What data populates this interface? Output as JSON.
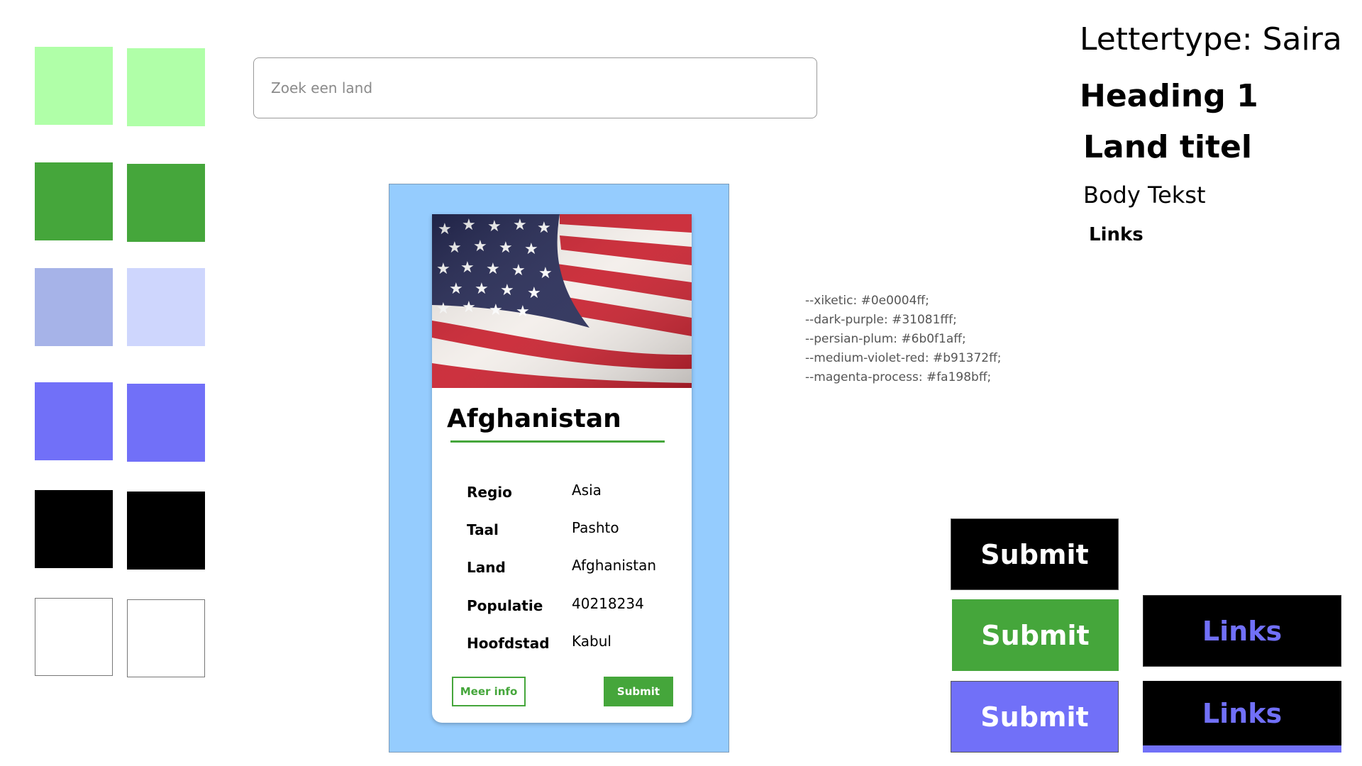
{
  "swatches": {
    "left": [
      "#b0ffa8",
      "#45a63b",
      "#a6b3e8",
      "#7170f8",
      "#000000",
      "#ffffff"
    ],
    "right": [
      "#b0ffa8",
      "#45a63b",
      "#ced6fd",
      "#7170f8",
      "#000000",
      "#ffffff"
    ]
  },
  "search": {
    "placeholder": "Zoek een land"
  },
  "card": {
    "title": "Afghanistan",
    "rows": [
      {
        "label": "Regio",
        "value": "Asia"
      },
      {
        "label": "Taal",
        "value": "Pashto"
      },
      {
        "label": "Land",
        "value": "Afghanistan"
      },
      {
        "label": "Populatie",
        "value": "40218234"
      },
      {
        "label": "Hoofdstad",
        "value": "Kabul"
      }
    ],
    "more_info_label": "Meer info",
    "submit_label": "Submit"
  },
  "typography": {
    "font_label": "Lettertype: Saira",
    "heading1": "Heading 1",
    "land_titel": "Land titel",
    "body_tekst": "Body Tekst",
    "links": "Links"
  },
  "color_vars": [
    "--xiketic: #0e0004ff;",
    "--dark-purple: #31081fff;",
    "--persian-plum: #6b0f1aff;",
    "--medium-violet-red: #b91372ff;",
    "--magenta-process: #fa198bff;"
  ],
  "buttons": {
    "submit_black": "Submit",
    "submit_green": "Submit",
    "submit_purple": "Submit",
    "links_1": "Links",
    "links_2": "Links"
  },
  "colors": {
    "green": "#45a63b",
    "light_green": "#b0ffa8",
    "purple": "#7170f8",
    "panel_blue": "#95ccfe",
    "black": "#000000"
  }
}
